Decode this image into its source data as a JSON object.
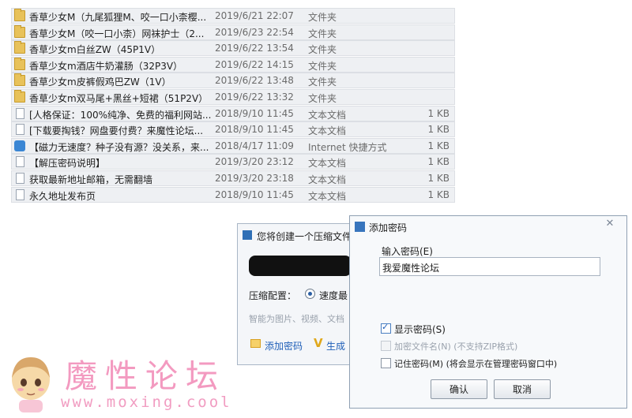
{
  "files": [
    {
      "name": "香草少女M（九尾狐狸M、咬一口小柰樱...",
      "date": "2019/6/21 22:07",
      "type": "文件夹",
      "size": "",
      "icon": "folder-icon"
    },
    {
      "name": "香草少女M（咬一口小柰）网袜护士（2...",
      "date": "2019/6/23 22:54",
      "type": "文件夹",
      "size": "",
      "icon": "folder-icon"
    },
    {
      "name": "香草少女m白丝ZW（45P1V）",
      "date": "2019/6/22 13:54",
      "type": "文件夹",
      "size": "",
      "icon": "folder-icon"
    },
    {
      "name": "香草少女m酒店牛奶灌肠（32P3V）",
      "date": "2019/6/22 14:15",
      "type": "文件夹",
      "size": "",
      "icon": "folder-icon"
    },
    {
      "name": "香草少女m皮裤假鸡巴ZW（1V）",
      "date": "2019/6/22 13:48",
      "type": "文件夹",
      "size": "",
      "icon": "folder-icon"
    },
    {
      "name": "香草少女m双马尾+黑丝+短裙（51P2V）",
      "date": "2019/6/22 13:32",
      "type": "文件夹",
      "size": "",
      "icon": "folder-icon"
    },
    {
      "name": "[人格保证：100%纯净、免费的福利网站...",
      "date": "2018/9/10 11:45",
      "type": "文本文档",
      "size": "1 KB",
      "icon": "document-icon"
    },
    {
      "name": "[下载要掏钱？网盘要付费？来魔性论坛...",
      "date": "2018/9/10 11:45",
      "type": "文本文档",
      "size": "1 KB",
      "icon": "document-icon"
    },
    {
      "name": "【磁力无速度？种子没有源？没关系，来...",
      "date": "2018/4/17 11:09",
      "type": "Internet 快捷方式",
      "size": "1 KB",
      "icon": "internet-shortcut-icon"
    },
    {
      "name": "【解压密码说明】",
      "date": "2019/3/20 23:12",
      "type": "文本文档",
      "size": "1 KB",
      "icon": "document-icon"
    },
    {
      "name": "获取最新地址邮箱，无需翻墙",
      "date": "2019/3/20 23:18",
      "type": "文本文档",
      "size": "1 KB",
      "icon": "document-icon"
    },
    {
      "name": "永久地址发布页",
      "date": "2018/9/10 11:45",
      "type": "文本文档",
      "size": "1 KB",
      "icon": "document-icon"
    }
  ],
  "create_dialog": {
    "title": "您将创建一个压缩文件",
    "config_label": "压缩配置：",
    "config_option": "速度最",
    "hint": "智能为图片、视频、文档",
    "add_password_link": "添加密码",
    "generate_link": "生成"
  },
  "password_dialog": {
    "title": "添加密码",
    "input_label": "输入密码(E)",
    "password_value": "我爱魔性论坛",
    "show_password": {
      "label": "显示密码(S)",
      "checked": true
    },
    "encrypt_filenames": {
      "label": "加密文件名(N) (不支持ZIP格式)",
      "checked": false,
      "disabled": true
    },
    "remember_password": {
      "label": "记住密码(M) (将会显示在管理密码窗口中)",
      "checked": false
    },
    "ok_label": "确认",
    "cancel_label": "取消"
  },
  "watermark": {
    "title": "魔性论坛",
    "url": "www.moxing.cool"
  }
}
